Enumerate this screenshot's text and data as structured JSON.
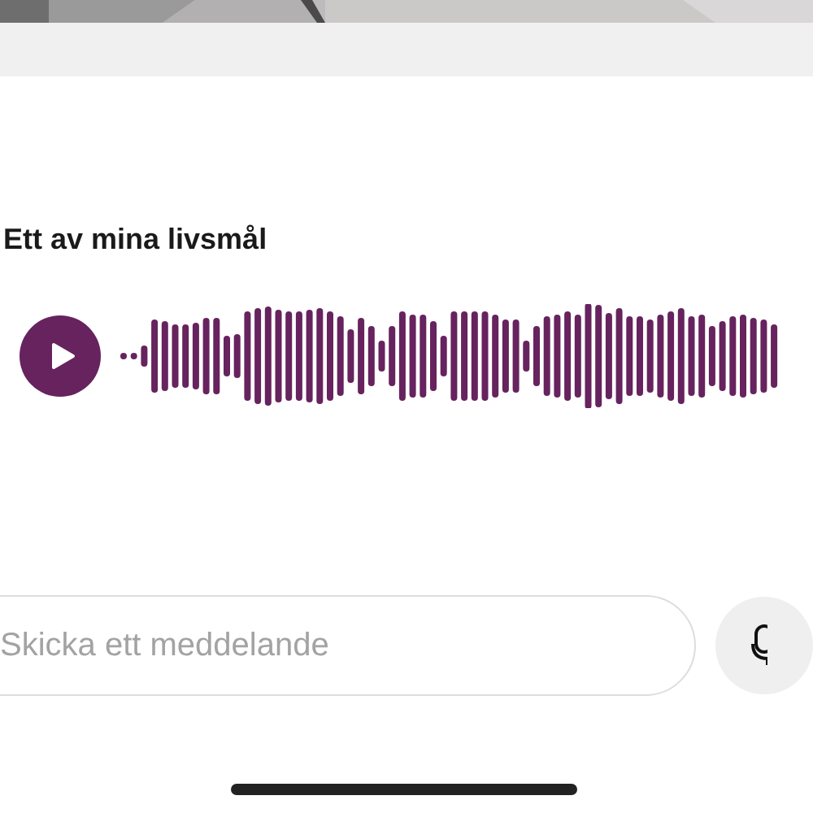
{
  "message": {
    "title": "Ett av mina livsmål",
    "audio": {
      "playing": false
    }
  },
  "composer": {
    "placeholder": "Skicka ett meddelande"
  }
}
